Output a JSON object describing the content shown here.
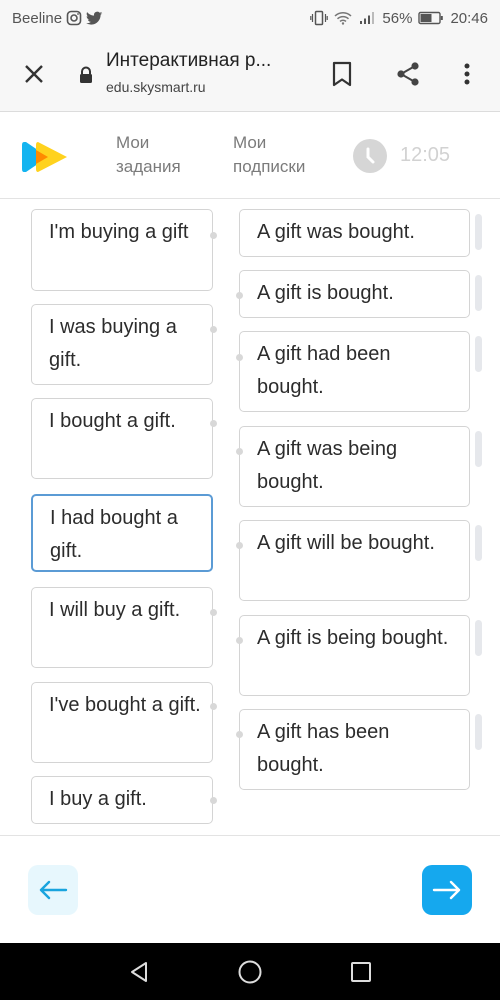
{
  "status_bar": {
    "carrier": "Beeline",
    "notification_icons": [
      "instagram-icon",
      "twitter-icon"
    ],
    "system_icons": [
      "vibrate-icon",
      "wifi-icon",
      "signal-icon"
    ],
    "battery": "56%",
    "time": "20:46"
  },
  "browser": {
    "page_title": "Интерактивная р...",
    "url": "edu.skysmart.ru",
    "icons": {
      "close": "close-icon",
      "lock": "lock-icon",
      "bookmark": "bookmark-icon",
      "share": "share-icon",
      "menu": "more-vert-icon"
    }
  },
  "app_header": {
    "nav": [
      {
        "line1": "Мои",
        "line2": "задания"
      },
      {
        "line1": "Мои",
        "line2": "подписки"
      }
    ],
    "timer": "12:05",
    "colors": {
      "logo_blue": "#14b4f0",
      "logo_yellow": "#ffd21e",
      "logo_orange": "#ff8a00"
    }
  },
  "exercise": {
    "left_items": [
      {
        "text": "I'm buying a gift",
        "selected": false
      },
      {
        "text": "I was buying a gift.",
        "selected": false
      },
      {
        "text": "I bought a gift.",
        "selected": false
      },
      {
        "text": "I had bought a gift.",
        "selected": true
      },
      {
        "text": "I will buy a gift.",
        "selected": false
      },
      {
        "text": "I've bought a gift.",
        "selected": false
      },
      {
        "text": "I buy a gift.",
        "selected": false
      }
    ],
    "right_items": [
      {
        "text": "A gift was bought."
      },
      {
        "text": "A gift is bought."
      },
      {
        "text": "A gift had been bought."
      },
      {
        "text": "A gift was being bought."
      },
      {
        "text": "A gift will be bought."
      },
      {
        "text": "A gift is being bought."
      },
      {
        "text": "A gift has been bought."
      }
    ],
    "selected_border_color": "#5b9bd5"
  },
  "footer": {
    "prev_icon": "arrow-left-icon",
    "next_icon": "arrow-right-icon",
    "colors": {
      "prev_bg": "#e7f7fd",
      "next_bg": "#15a8ee"
    }
  },
  "android_nav": {
    "icons": [
      "back-icon",
      "home-icon",
      "recents-icon"
    ]
  }
}
